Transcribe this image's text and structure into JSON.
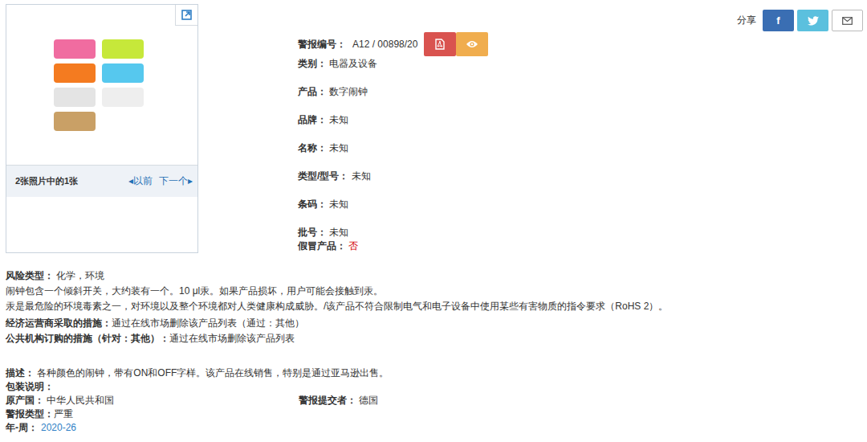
{
  "gallery": {
    "caption": "2张照片中的1张",
    "prev": {
      "arrow": "◂",
      "label": "以前"
    },
    "next": {
      "label": "下一个",
      "arrow": "▸"
    }
  },
  "share": {
    "label": "分享",
    "buttons": [
      {
        "kind": "facebook",
        "text": "f",
        "color": "#3a6eb3"
      },
      {
        "kind": "twitter",
        "color": "#5bc0de"
      },
      {
        "kind": "mail",
        "color": "#ffffff"
      }
    ]
  },
  "alert": {
    "label": "警报编号：",
    "value": "A12 / 00898/20",
    "actions": [
      {
        "kind": "pdf",
        "color": "#d9534f"
      },
      {
        "kind": "view",
        "color": "#f0ad4e"
      }
    ]
  },
  "fields": [
    {
      "label": "类别：",
      "value": "电器及设备",
      "kind": "text"
    },
    {
      "label": "产品：",
      "value": "数字闹钟",
      "kind": "text"
    },
    {
      "label": "品牌：",
      "value": "未知",
      "kind": "text"
    },
    {
      "label": "名称：",
      "value": "未知",
      "kind": "text"
    },
    {
      "label": "类型/型号：",
      "value": "未知",
      "kind": "text"
    },
    {
      "label": "条码：",
      "value": "未知",
      "kind": "text"
    },
    {
      "label": "批号：",
      "value": "未知",
      "kind": "text"
    },
    {
      "label": "假冒产品：",
      "value": "否",
      "kind": "flag"
    }
  ],
  "risk": {
    "label": "风险类型：",
    "value": "化学，环境",
    "lines": [
      "闹钟包含一个倾斜开关，大约装有一个。10 μl汞。如果产品损坏，用户可能会接触到汞。",
      "汞是最危险的环境毒素之一，对环境以及整个环境都对人类健康构成威胁。/该产品不符合限制电气和电子设备中使用某些有害物质的指令要求（RoHS 2）。"
    ]
  },
  "measures": [
    {
      "label": "经济运营商采取的措施：",
      "value": "通过在线市场删除该产品列表（通过：其他）"
    },
    {
      "label": "公共机构订购的措施（针对：其他）：",
      "value": "通过在线市场删除该产品列表"
    }
  ],
  "description": {
    "label": "描述：",
    "value": "各种颜色的闹钟，带有ON和OFF字样。该产品在线销售，特别是通过亚马逊出售。"
  },
  "packaging": {
    "label": "包装说明："
  },
  "details": {
    "origin": {
      "label": "原产国：",
      "value": "中华人民共和国"
    },
    "submitter": {
      "label": "警报提交者：",
      "value": "德国"
    },
    "alert_type": {
      "label": "警报类型：",
      "value": "严重"
    },
    "week": {
      "label": "年-周：",
      "value": "2020-26"
    }
  }
}
